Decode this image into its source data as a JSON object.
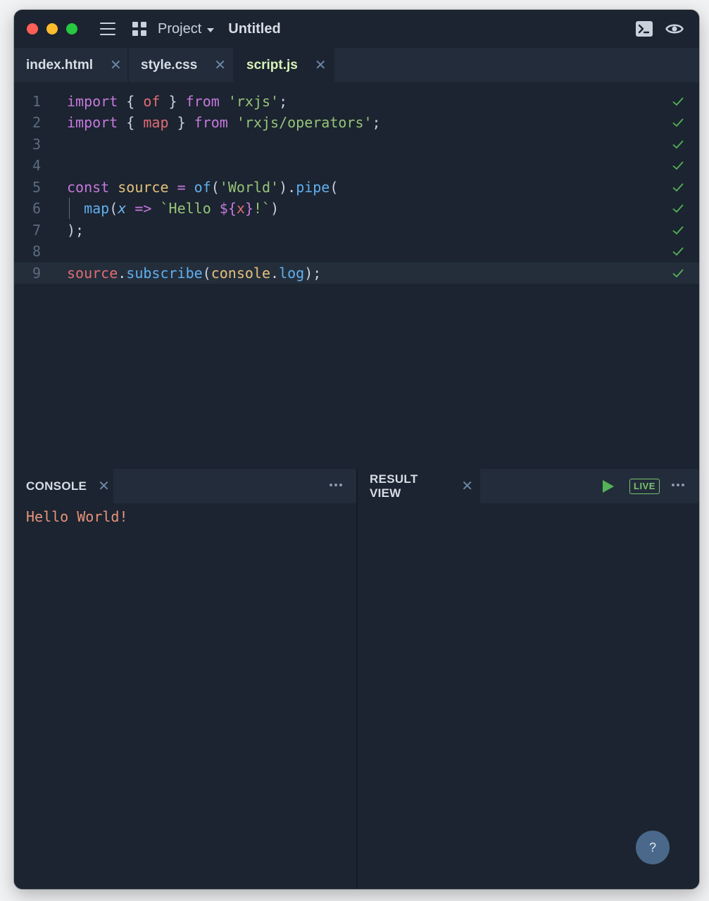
{
  "titlebar": {
    "project_label": "Project",
    "document_title": "Untitled"
  },
  "tabs": [
    {
      "label": "index.html",
      "active": false
    },
    {
      "label": "style.css",
      "active": false
    },
    {
      "label": "script.js",
      "active": true
    }
  ],
  "editor": {
    "line_numbers": [
      "1",
      "2",
      "3",
      "4",
      "5",
      "6",
      "7",
      "8",
      "9"
    ],
    "lines": [
      "import { of } from 'rxjs';",
      "import { map } from 'rxjs/operators';",
      "",
      "",
      "const source = of('World').pipe(",
      "  map(x => `Hello ${x}!`)",
      ");",
      "",
      "source.subscribe(console.log);"
    ],
    "current_line": 9,
    "status_icon": "check-icon"
  },
  "console": {
    "tab_label": "CONSOLE",
    "output": "Hello World!"
  },
  "result": {
    "tab_label": "RESULT VIEW",
    "live_label": "LIVE"
  },
  "help": {
    "label": "?"
  },
  "colors": {
    "background": "#1b2430",
    "tabbar": "#222c3a",
    "active_tab_text": "#d9f2b8",
    "keyword": "#c678dd",
    "function": "#61afef",
    "string": "#98c379",
    "variable": "#e5c07b",
    "check": "#54b356",
    "console_text": "#e8937a"
  }
}
